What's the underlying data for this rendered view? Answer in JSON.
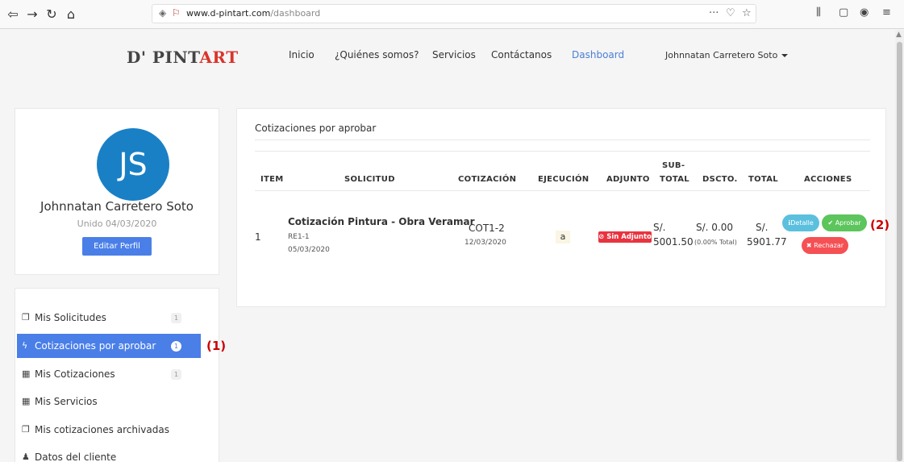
{
  "browser": {
    "url_host": "www.d-pintart.com",
    "url_path": "/dashboard"
  },
  "logo": {
    "text_main": "D' PINT",
    "text_accent": "ART"
  },
  "nav": {
    "inicio": "Inicio",
    "quienes": "¿Quiénes somos?",
    "servicios": "Servicios",
    "contactanos": "Contáctanos",
    "dashboard": "Dashboard",
    "user": "Johnnatan Carretero Soto"
  },
  "profile": {
    "initials": "JS",
    "name": "Johnnatan Carretero Soto",
    "joined": "Unido 04/03/2020",
    "edit_label": "Editar Perfil"
  },
  "menu": {
    "items": [
      {
        "label": "Mis Solicitudes",
        "badge": "1",
        "icon": "copy-icon"
      },
      {
        "label": "Cotizaciones por aprobar",
        "badge": "1",
        "icon": "bolt-icon"
      },
      {
        "label": "Mis Cotizaciones",
        "badge": "1",
        "icon": "calculator-icon"
      },
      {
        "label": "Mis Servicios",
        "badge": "",
        "icon": "calculator-icon"
      },
      {
        "label": "Mis cotizaciones archivadas",
        "badge": "",
        "icon": "copy-icon"
      },
      {
        "label": "Datos del cliente",
        "badge": "",
        "icon": "user-icon"
      }
    ]
  },
  "annotations": {
    "one": "(1)",
    "two": "(2)"
  },
  "main": {
    "title": "Cotizaciones por aprobar",
    "headers": {
      "item": "ITEM",
      "solicitud": "SOLICITUD",
      "cotizacion": "COTIZACIÓN",
      "ejecucion": "EJECUCIÓN",
      "adjunto": "ADJUNTO",
      "subtotal_1": "SUB-",
      "subtotal_2": "TOTAL",
      "dscto": "DSCTO.",
      "total": "TOTAL",
      "acciones": "ACCIONES"
    },
    "row": {
      "item": "1",
      "solicitud_title": "Cotización Pintura - Obra Veramar",
      "solicitud_code": "RE1-1",
      "solicitud_date": "05/03/2020",
      "cotizacion_code": "COT1-2",
      "cotizacion_date": "12/03/2020",
      "ejecucion": "a",
      "adjunto": "Sin Adjunto",
      "subtotal_currency": "S/.",
      "subtotal_value": "5001.50",
      "dscto_value": "S/. 0.00",
      "dscto_note": "(0.00% Total)",
      "total_currency": "S/.",
      "total_value": "5901.77",
      "btn_detalle": "Detalle",
      "btn_aprobar": "Aprobar",
      "btn_rechazar": "Rechazar"
    }
  }
}
